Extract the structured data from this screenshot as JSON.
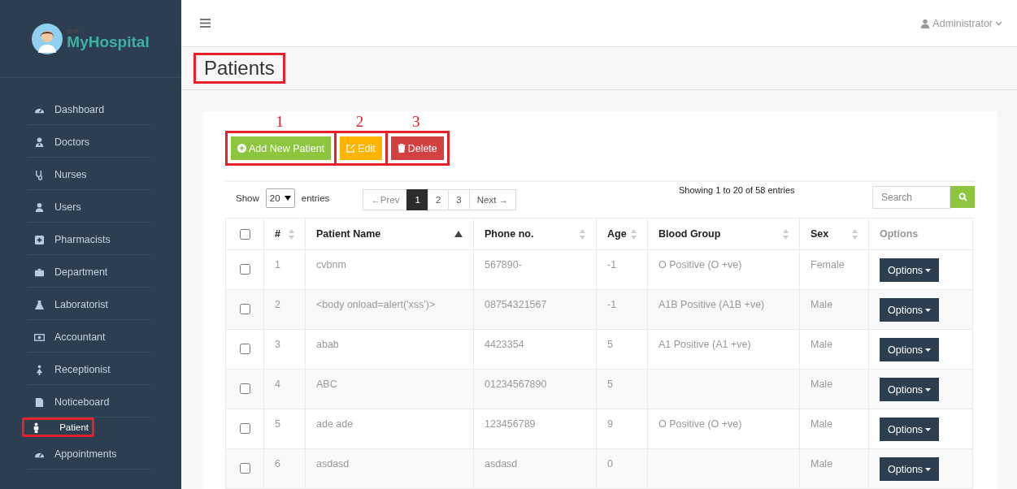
{
  "sidebar": {
    "logo": {
      "small_text": "EHR",
      "name": "MyHospital"
    },
    "items": [
      {
        "label": "Dashboard",
        "selected": false,
        "highlighted": false
      },
      {
        "label": "Doctors",
        "selected": false,
        "highlighted": false
      },
      {
        "label": "Nurses",
        "selected": false,
        "highlighted": false
      },
      {
        "label": "Users",
        "selected": false,
        "highlighted": false
      },
      {
        "label": "Pharmacists",
        "selected": false,
        "highlighted": false
      },
      {
        "label": "Department",
        "selected": false,
        "highlighted": false
      },
      {
        "label": "Laboratorist",
        "selected": false,
        "highlighted": false
      },
      {
        "label": "Accountant",
        "selected": false,
        "highlighted": false
      },
      {
        "label": "Receptionist",
        "selected": false,
        "highlighted": false
      },
      {
        "label": "Noticeboard",
        "selected": false,
        "highlighted": false
      },
      {
        "label": "Patient",
        "selected": true,
        "highlighted": true
      },
      {
        "label": "Appointments",
        "selected": false,
        "highlighted": false
      }
    ]
  },
  "topbar": {
    "user": "Administrator"
  },
  "page_title": {
    "text": "Patients",
    "highlighted": true
  },
  "actions": [
    {
      "kind": "add",
      "label": "Add New Patient",
      "callout": "1",
      "highlighted": true
    },
    {
      "kind": "edit",
      "label": "Edit",
      "callout": "2",
      "highlighted": true
    },
    {
      "kind": "delete",
      "label": "Delete",
      "callout": "3",
      "highlighted": true
    }
  ],
  "length": {
    "label_before": "Show",
    "value": "20",
    "label_after": "entries"
  },
  "pagination": [
    {
      "label": "←Prev",
      "selected": false
    },
    {
      "label": "1",
      "selected": true
    },
    {
      "label": "2",
      "selected": false
    },
    {
      "label": "3",
      "selected": false
    },
    {
      "label": "Next →",
      "selected": false
    }
  ],
  "info": "Showing 1 to 20 of 58 entries",
  "search": {
    "placeholder": "Search"
  },
  "table": {
    "columns": [
      {
        "label": "#",
        "sortable": true,
        "sorted": false
      },
      {
        "label": "Patient Name",
        "sortable": true,
        "sorted": true
      },
      {
        "label": "Phone no.",
        "sortable": true,
        "sorted": false
      },
      {
        "label": "Age",
        "sortable": true,
        "sorted": false
      },
      {
        "label": "Blood Group",
        "sortable": true,
        "sorted": false
      },
      {
        "label": "Sex",
        "sortable": true,
        "sorted": false
      },
      {
        "label": "Options",
        "sortable": false,
        "sorted": false
      }
    ],
    "header_checked": false,
    "rows": [
      {
        "checked": false,
        "cells": [
          "1",
          "cvbnm",
          "567890-",
          "-1",
          "O Positive (O +ve)",
          "Female"
        ],
        "button": "Options"
      },
      {
        "checked": false,
        "cells": [
          "2",
          "<body onload=alert('xss')>",
          "08754321567",
          "-1",
          "A1B Positive (A1B +ve)",
          "Male"
        ],
        "button": "Options"
      },
      {
        "checked": false,
        "cells": [
          "3",
          "abab",
          "4423354",
          "5",
          "A1 Positive (A1 +ve)",
          "Male"
        ],
        "button": "Options"
      },
      {
        "checked": false,
        "cells": [
          "4",
          "ABC",
          "01234567890",
          "5",
          "",
          "Male"
        ],
        "button": "Options"
      },
      {
        "checked": false,
        "cells": [
          "5",
          "ade ade",
          "123456789",
          "9",
          "O Positive (O +ve)",
          "Male"
        ],
        "button": "Options"
      },
      {
        "checked": false,
        "cells": [
          "6",
          "asdasd",
          "asdasd",
          "0",
          "",
          "Male"
        ],
        "button": "Options"
      }
    ]
  }
}
